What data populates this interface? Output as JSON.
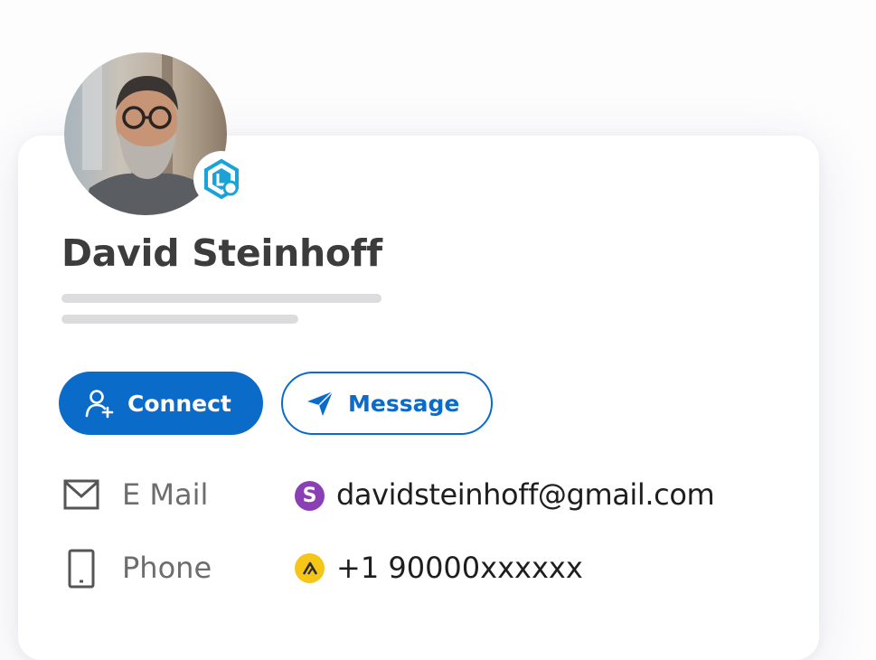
{
  "profile": {
    "name": "David Steinhoff"
  },
  "actions": {
    "connect_label": "Connect",
    "message_label": "Message"
  },
  "contact": {
    "email": {
      "label": "E Mail",
      "value": "davidsteinhoff@gmail.com",
      "bullet_letter": "S",
      "bullet_color": "#8a3fb5"
    },
    "phone": {
      "label": "Phone",
      "value": "+1 90000xxxxxx",
      "bullet_color": "#f5c518"
    }
  },
  "colors": {
    "accent": "#0b6bc9",
    "badge": "#1aa3d9"
  },
  "icons": {
    "connect": "add-user-icon",
    "message": "send-icon",
    "email": "envelope-icon",
    "phone": "phone-icon",
    "badge": "linkedin-sales-badge-icon"
  }
}
